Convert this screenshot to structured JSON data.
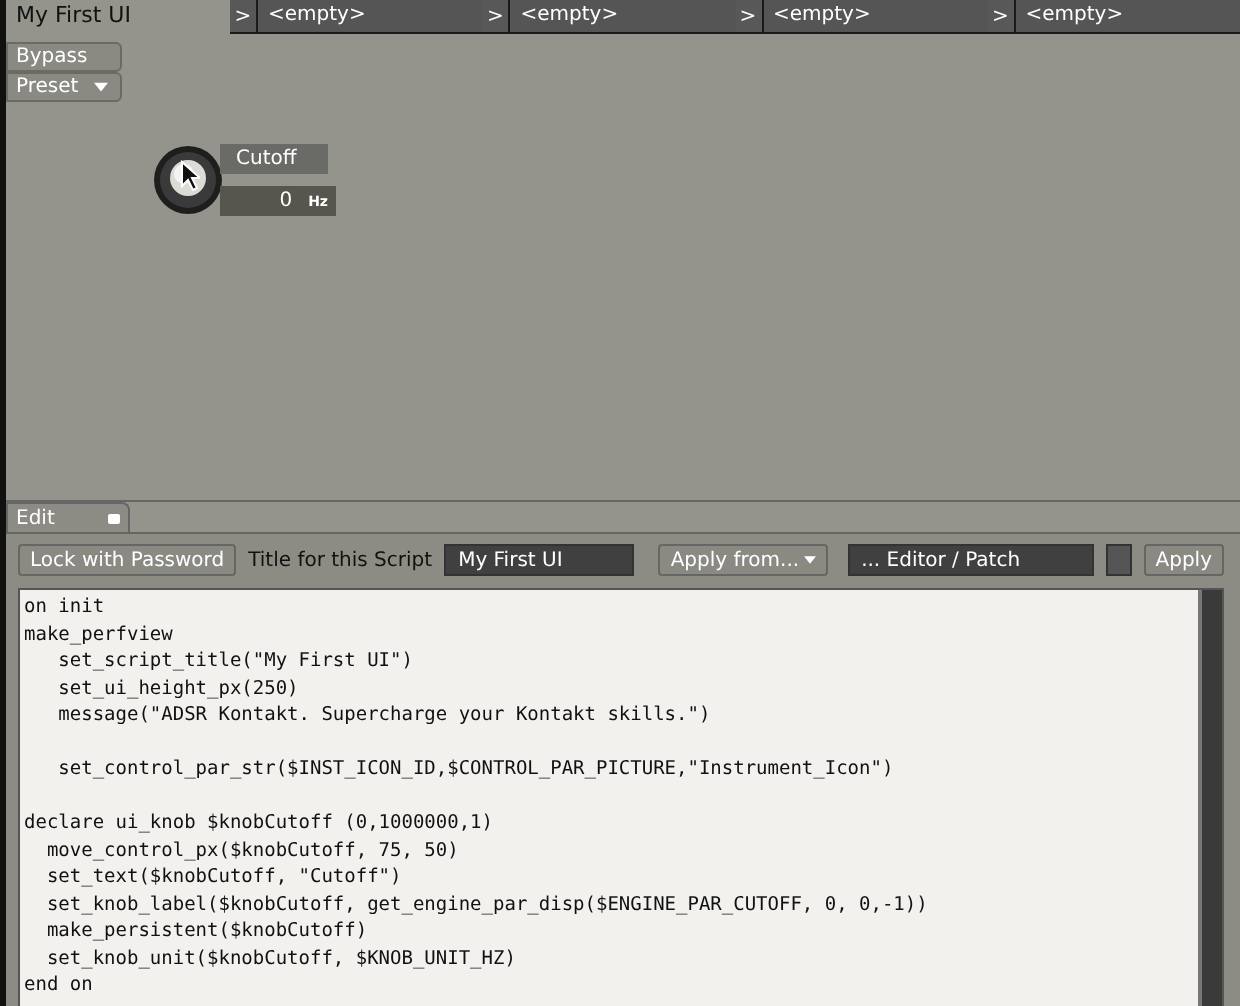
{
  "script_tabs": [
    {
      "title": "My First UI",
      "selected": true
    },
    {
      "arrow": ">",
      "title": "<empty>",
      "selected": false
    },
    {
      "arrow": ">",
      "title": "<empty>",
      "selected": false
    },
    {
      "arrow": ">",
      "title": "<empty>",
      "selected": false
    },
    {
      "arrow": ">",
      "title": "<empty>",
      "selected": false
    }
  ],
  "performance_view": {
    "buttons": [
      {
        "label": "Bypass",
        "kind": "plain"
      },
      {
        "label": "Preset",
        "kind": "dropdown"
      }
    ],
    "knob": {
      "label": "Cutoff",
      "value": "0",
      "unit": "Hz"
    }
  },
  "editor": {
    "tab": {
      "label": "Edit"
    },
    "toolbar": {
      "lock_button": "Lock with Password",
      "title_label": "Title for this Script",
      "title_value": "My First UI",
      "apply_from": "Apply from...",
      "source_field": "... Editor / Patch",
      "apply_button": "Apply"
    },
    "code_blocks": [
      [
        "on init",
        "make_perfview",
        "   set_script_title(\"My First UI\")",
        "   set_ui_height_px(250)",
        "   message(\"ADSR Kontakt. Supercharge your Kontakt skills.\")"
      ],
      [
        "   set_control_par_str($INST_ICON_ID,$CONTROL_PAR_PICTURE,\"Instrument_Icon\")"
      ],
      [
        "declare ui_knob $knobCutoff (0,1000000,1)",
        "  move_control_px($knobCutoff, 75, 50)",
        "  set_text($knobCutoff, \"Cutoff\")",
        "  set_knob_label($knobCutoff, get_engine_par_disp($ENGINE_PAR_CUTOFF, 0, 0,-1))",
        "  make_persistent($knobCutoff)",
        "  set_knob_unit($knobCutoff, $KNOB_UNIT_HZ)",
        "end on"
      ]
    ]
  }
}
